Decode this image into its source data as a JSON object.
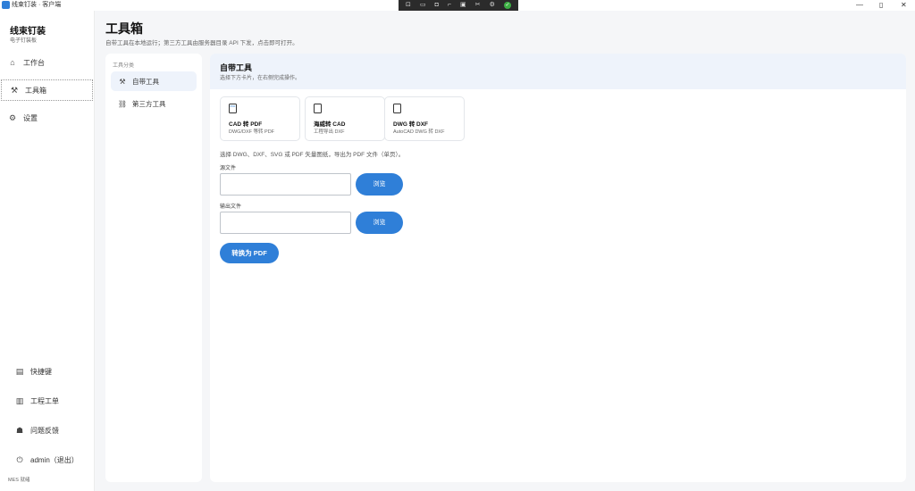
{
  "window": {
    "title": "线束钉装 · 客户端",
    "rec_toolbar_icons": [
      "fit-icon",
      "window-icon",
      "camera-icon",
      "cut-icon",
      "image-icon",
      "scissors-icon",
      "settings-icon",
      "check-icon"
    ],
    "minimize": "—",
    "maximize": "▯",
    "close": "✕"
  },
  "sidebar": {
    "brand_title": "线束钉装",
    "brand_subtitle": "电子钉装板",
    "nav": [
      {
        "label": "工作台",
        "icon": "home-icon"
      },
      {
        "label": "工具箱",
        "icon": "wrench-icon"
      },
      {
        "label": "设置",
        "icon": "gear-icon"
      }
    ],
    "bottom": [
      {
        "label": "快捷键",
        "icon": "keyboard-icon"
      },
      {
        "label": "工程工单",
        "icon": "books-icon"
      },
      {
        "label": "问题反馈",
        "icon": "feedback-icon"
      },
      {
        "label": "admin（退出）",
        "icon": "power-icon"
      }
    ],
    "footer": "MES 就绪"
  },
  "header": {
    "title": "工具箱",
    "description": "自带工具在本地运行；第三方工具由服务器目录 API 下发，点击即可打开。"
  },
  "categories": {
    "heading": "工具分类",
    "items": [
      {
        "label": "自带工具",
        "icon": "wrench-icon"
      },
      {
        "label": "第三方工具",
        "icon": "link-icon"
      }
    ]
  },
  "main": {
    "title": "自带工具",
    "subtitle": "选择下方卡片，在右侧完成操作。",
    "cards": [
      {
        "name": "CAD 转 PDF",
        "desc": "DWG/DXF 等转 PDF",
        "icon": "pdf-file-icon"
      },
      {
        "name": "海威转 CAD",
        "desc": "工程导出 DXF",
        "icon": "file-icon"
      },
      {
        "name": "DWG 转 DXF",
        "desc": "AutoCAD DWG 转 DXF",
        "icon": "file-add-icon"
      }
    ],
    "hint": "选择 DWG、DXF、SVG 或 PDF 矢量图纸，导出为 PDF 文件（单页）。",
    "source_label": "源文件",
    "source_value": "",
    "output_label": "输出文件",
    "output_value": "",
    "browse_label": "浏览",
    "convert_label": "转换为 PDF"
  },
  "colors": {
    "accent": "#2f7fd8",
    "header_bg": "#eef3fb",
    "page_bg": "#f5f6f8"
  }
}
